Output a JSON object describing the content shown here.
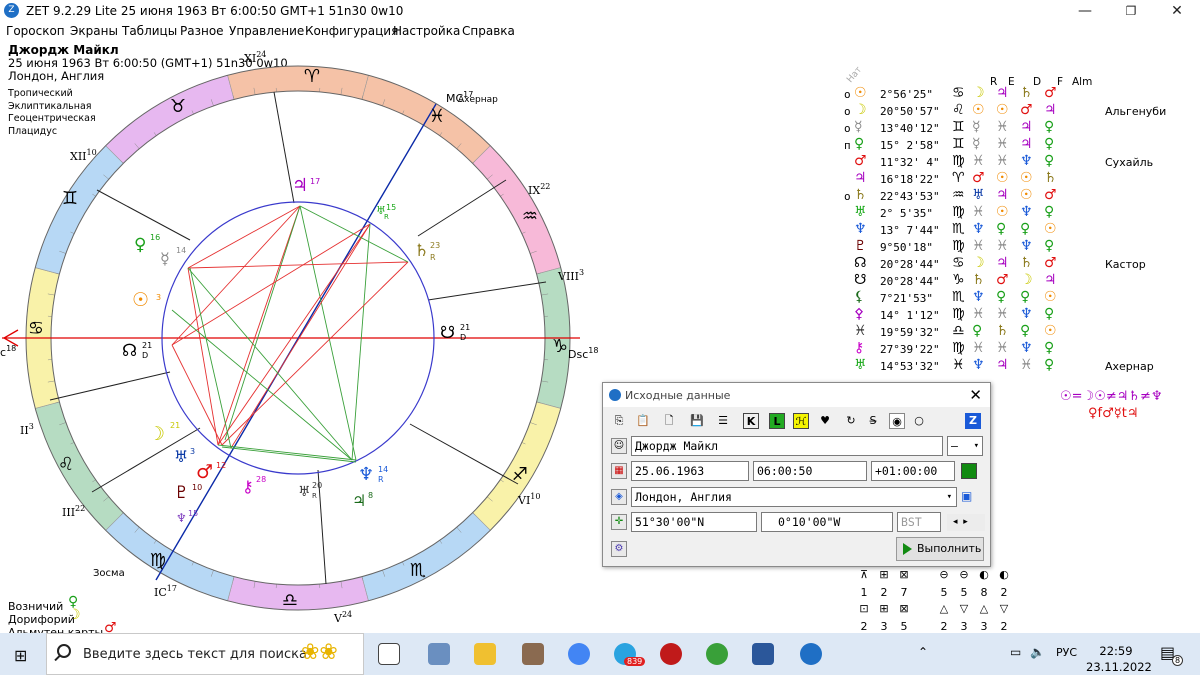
{
  "window": {
    "title": "ZET 9.2.29 Lite   25 июня 1963  Вт   6:00:50 GMT+1 51n30  0w10",
    "min": "—",
    "max": "❐",
    "close": "✕"
  },
  "menu": [
    "Гороскоп",
    "Экраны",
    "Таблицы",
    "Разное",
    "Управление",
    "Конфигурация",
    "Настройка",
    "Справка"
  ],
  "header": {
    "name": "Джордж Майкл",
    "line2": "25 июня 1963  Вт   6:00:50 (GMT+1) 51n30  0w10",
    "line3": "Лондон, Англия"
  },
  "system": [
    "Тропический",
    "Эклиптикальная",
    "Геоцентрическая",
    "Плацидус"
  ],
  "wheel": {
    "houses": [
      {
        "label": "XI",
        "sup": "24"
      },
      {
        "label": "XII",
        "sup": "10"
      },
      {
        "label": "IX",
        "sup": "22"
      },
      {
        "label": "VIII",
        "sup": "3"
      },
      {
        "label": "II",
        "sup": "3"
      },
      {
        "label": "III",
        "sup": "22"
      },
      {
        "label": "VI",
        "sup": "10"
      },
      {
        "label": "V",
        "sup": "24"
      },
      {
        "label": "IC",
        "sup": "17"
      },
      {
        "label": "MC",
        "sup": "17"
      },
      {
        "label": "Dsc",
        "sup": "18"
      },
      {
        "label": "c",
        "sup": "18"
      }
    ],
    "signs": [
      "♈",
      "♉",
      "♊",
      "♋",
      "♌",
      "♍",
      "♎",
      "♏",
      "♐",
      "♑",
      "♒",
      "♓"
    ],
    "sign_colors": {
      "fire": "#f5c2a7",
      "earth": "#b6dcc2",
      "air": "#f9f2a9",
      "water": "#b7d8f5",
      "purple": "#e7b8f0",
      "pink": "#f7b9d8"
    },
    "planets": [
      {
        "g": "♃",
        "d": "17",
        "color": "#a600c0"
      },
      {
        "g": "♅",
        "d": "15",
        "r": "R",
        "color": "#18a818"
      },
      {
        "g": "♄",
        "d": "23",
        "r": "R",
        "color": "#8c7a1e"
      },
      {
        "g": "♀",
        "d": "16",
        "color": "#1aa01a"
      },
      {
        "g": "☿",
        "d": "14",
        "color": "#888888"
      },
      {
        "g": "☉",
        "d": "3",
        "color": "#f08a00"
      },
      {
        "g": "☊",
        "d": "21",
        "r": "D",
        "color": "#000000"
      },
      {
        "g": "☋",
        "d": "21",
        "r": "D",
        "color": "#000000"
      },
      {
        "g": "☽",
        "d": "21",
        "color": "#c8c800"
      },
      {
        "g": "♅",
        "d": "3",
        "color": "#0b3aa6"
      },
      {
        "g": "♂",
        "d": "12",
        "color": "#e01010"
      },
      {
        "g": "♇",
        "d": "10",
        "color": "#6a0000"
      },
      {
        "g": "⚷",
        "d": "28",
        "color": "#c800c8"
      },
      {
        "g": "♆",
        "d": "15",
        "color": "#8040c0"
      },
      {
        "g": "♅",
        "d": "20",
        "r": "R",
        "color": "#333333"
      },
      {
        "g": "♆",
        "d": "14",
        "r": "R",
        "color": "#1a5ad8"
      },
      {
        "g": "♃",
        "d": "8",
        "color": "#1a6a1a"
      }
    ],
    "stars": [
      "Ахернар",
      "Зосма"
    ]
  },
  "table": {
    "header": [
      "Нат",
      "R",
      "E",
      "D",
      "F",
      "Alm"
    ],
    "rows": [
      {
        "m": "o",
        "g": "☉",
        "c": "#f08a00",
        "deg": "2°56'25\"",
        "s": "♋",
        "r": [
          "☽",
          "♃",
          "♄",
          "♂"
        ],
        "rc": [
          "#c8c800",
          "#a600c0",
          "#8c7a1e",
          "#e01010"
        ],
        "star": ""
      },
      {
        "m": "o",
        "g": "☽",
        "c": "#c8c800",
        "deg": "20°50'57\"",
        "s": "♌",
        "r": [
          "☉",
          "☉",
          "♂",
          "♃"
        ],
        "rc": [
          "#f08a00",
          "#f08a00",
          "#e01010",
          "#a600c0"
        ],
        "star": "Альгенуби"
      },
      {
        "m": "o",
        "g": "☿",
        "c": "#888888",
        "deg": "13°40'12\"",
        "s": "♊",
        "r": [
          "☿",
          "♓",
          "♃",
          "♀"
        ],
        "rc": [
          "#888",
          "#888",
          "#a600c0",
          "#1aa01a"
        ],
        "star": ""
      },
      {
        "m": "п",
        "g": "♀",
        "c": "#1aa01a",
        "deg": "15° 2'58\"",
        "s": "♊",
        "r": [
          "☿",
          "♓",
          "♃",
          "♀"
        ],
        "rc": [
          "#888",
          "#888",
          "#a600c0",
          "#1aa01a"
        ],
        "star": ""
      },
      {
        "m": "",
        "g": "♂",
        "c": "#e01010",
        "deg": "11°32' 4\"",
        "s": "♍",
        "r": [
          "♓",
          "♓",
          "♆",
          "♀"
        ],
        "rc": [
          "#888",
          "#888",
          "#1a5ad8",
          "#1aa01a"
        ],
        "star": "Сухайль"
      },
      {
        "m": "",
        "g": "♃",
        "c": "#a600c0",
        "deg": "16°18'22\"",
        "s": "♈",
        "r": [
          "♂",
          "☉",
          "☉",
          "♄"
        ],
        "rc": [
          "#e01010",
          "#f08a00",
          "#f08a00",
          "#8c7a1e"
        ],
        "star": ""
      },
      {
        "m": "o",
        "g": "♄",
        "c": "#8c7a1e",
        "deg": "22°43'53\"",
        "s": "♒",
        "r": [
          "♅",
          "♃",
          "☉",
          "♂"
        ],
        "rc": [
          "#0b3aa6",
          "#a600c0",
          "#f08a00",
          "#e01010"
        ],
        "star": ""
      },
      {
        "m": "",
        "g": "♅",
        "c": "#18a818",
        "deg": "2° 5'35\"",
        "s": "♍",
        "r": [
          "♓",
          "☉",
          "♆",
          "♀"
        ],
        "rc": [
          "#888",
          "#f08a00",
          "#1a5ad8",
          "#1aa01a"
        ],
        "star": ""
      },
      {
        "m": "",
        "g": "♆",
        "c": "#1a5ad8",
        "deg": "13° 7'44\"",
        "s": "♏",
        "r": [
          "♆",
          "♀",
          "♀",
          "☉"
        ],
        "rc": [
          "#1a5ad8",
          "#1aa01a",
          "#1aa01a",
          "#f08a00"
        ],
        "star": ""
      },
      {
        "m": "",
        "g": "♇",
        "c": "#6a0000",
        "deg": "9°50'18\"",
        "s": "♍",
        "r": [
          "♓",
          "♓",
          "♆",
          "♀"
        ],
        "rc": [
          "#888",
          "#888",
          "#1a5ad8",
          "#1aa01a"
        ],
        "star": ""
      },
      {
        "m": "",
        "g": "☊",
        "c": "#000",
        "deg": "20°28'44\"",
        "s": "♋",
        "r": [
          "☽",
          "♃",
          "♄",
          "♂"
        ],
        "rc": [
          "#c8c800",
          "#a600c0",
          "#8c7a1e",
          "#e01010"
        ],
        "star": "Кастор"
      },
      {
        "m": "",
        "g": "☋",
        "c": "#000",
        "deg": "20°28'44\"",
        "s": "♑",
        "r": [
          "♄",
          "♂",
          "☽",
          "♃"
        ],
        "rc": [
          "#8c7a1e",
          "#e01010",
          "#c8c800",
          "#a600c0"
        ],
        "star": ""
      },
      {
        "m": "",
        "g": "⚸",
        "c": "#1a6a1a",
        "deg": "7°21'53\"",
        "s": "♏",
        "r": [
          "♆",
          "♀",
          "♀",
          "☉"
        ],
        "rc": [
          "#1a5ad8",
          "#1aa01a",
          "#1aa01a",
          "#f08a00"
        ],
        "star": ""
      },
      {
        "m": "",
        "g": "⚴",
        "c": "#a600c0",
        "deg": "14° 1'12\"",
        "s": "♍",
        "r": [
          "♓",
          "♓",
          "♆",
          "♀"
        ],
        "rc": [
          "#888",
          "#888",
          "#1a5ad8",
          "#1aa01a"
        ],
        "star": ""
      },
      {
        "m": "",
        "g": "♓",
        "c": "#333",
        "deg": "19°59'32\"",
        "s": "♎",
        "r": [
          "♀",
          "♄",
          "♀",
          "☉"
        ],
        "rc": [
          "#1aa01a",
          "#8c7a1e",
          "#1aa01a",
          "#f08a00"
        ],
        "star": ""
      },
      {
        "m": "",
        "g": "⚷",
        "c": "#c800c8",
        "deg": "27°39'22\"",
        "s": "♍",
        "r": [
          "♓",
          "♓",
          "♆",
          "♀"
        ],
        "rc": [
          "#888",
          "#888",
          "#1a5ad8",
          "#1aa01a"
        ],
        "star": ""
      },
      {
        "m": "",
        "g": "♅",
        "c": "#18a818",
        "deg": "14°53'32\"",
        "s": "♓",
        "r": [
          "♆",
          "♃",
          "♓",
          "♀"
        ],
        "rc": [
          "#1a5ad8",
          "#a600c0",
          "#888",
          "#1aa01a"
        ],
        "star": "Ахернар"
      }
    ]
  },
  "formula": {
    "line1": "☉=☽☉≠♃♄≠♆",
    "line2": "♀f♂☿t♃"
  },
  "aspect_grid": {
    "icons1": [
      "⊼",
      "⊞",
      "⊠",
      "⊖",
      "⊖",
      "◐",
      "◐"
    ],
    "nums1": [
      "1",
      "2",
      "7",
      "5",
      "5",
      "8",
      "2"
    ],
    "icons2": [
      "⊡",
      "⊞",
      "⊠",
      "△",
      "▽",
      "△",
      "▽"
    ],
    "nums2": [
      "2",
      "3",
      "5",
      "2",
      "3",
      "3",
      "2"
    ]
  },
  "bottom_left": {
    "l1": "Возничий",
    "l2": "Дорифорий",
    "l3": "Альмутен карты"
  },
  "dialog": {
    "title": "Исходные данные",
    "name": "Джордж Майкл",
    "gender": "—",
    "date": "25.06.1963",
    "time": "06:00:50",
    "tz": "+01:00:00",
    "place": "Лондон, Англия",
    "lat": "51°30'00\"N",
    "lon": "0°10'00\"W",
    "dst": "BST",
    "run": "Выполнить"
  },
  "taskbar": {
    "search": "Введите здесь текст для поиска",
    "time": "22:59",
    "date": "23.11.2022",
    "lang": "РУС",
    "badge": "8",
    "tg_badge": "839"
  }
}
